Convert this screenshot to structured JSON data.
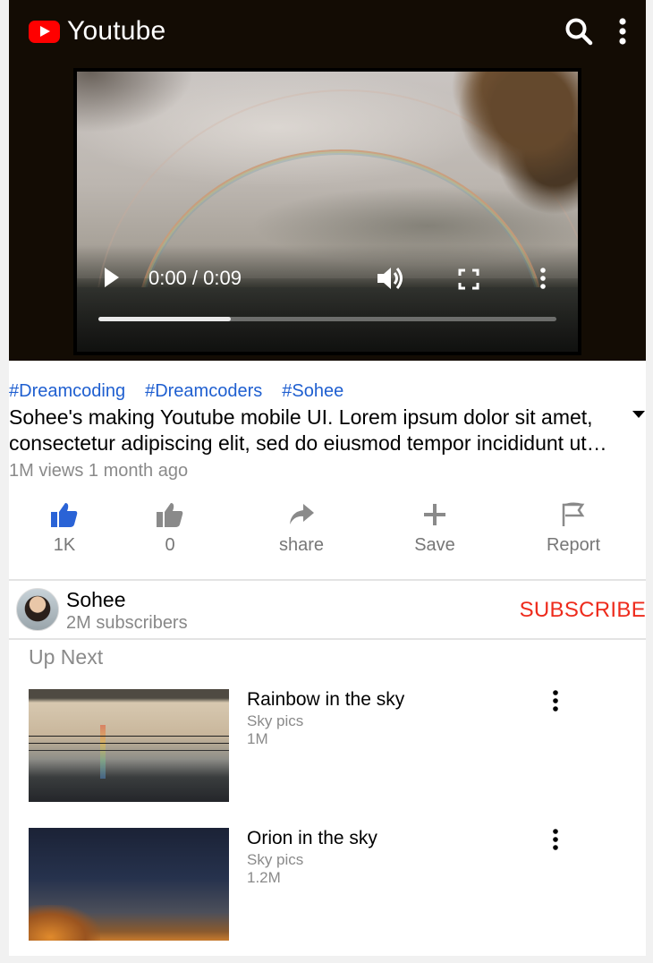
{
  "header": {
    "app_name": "Youtube",
    "icons": [
      "youtube-logo",
      "search-icon",
      "more-vert-icon"
    ]
  },
  "player": {
    "time": "0:00 / 0:09",
    "progress": 0.29,
    "icons": [
      "play-icon",
      "volume-icon",
      "fullscreen-icon",
      "more-vert-icon"
    ]
  },
  "video": {
    "hashtags": [
      "#Dreamcoding",
      "#Dreamcoders",
      "#Sohee"
    ],
    "title": "Sohee's making Youtube mobile UI. Lorem ipsum dolor sit amet, consectetur adipiscing elit, sed do eiusmod tempor incididunt ut labore et dolore magna aliqua.",
    "meta": "1M views 1 month ago"
  },
  "actions": [
    {
      "name": "like",
      "label": "1K",
      "icon": "thumbs-up-icon",
      "color": "#2a63d6"
    },
    {
      "name": "dislike",
      "label": "0",
      "icon": "thumbs-down-icon",
      "color": "#888888"
    },
    {
      "name": "share",
      "label": "share",
      "icon": "share-icon",
      "color": "#888888"
    },
    {
      "name": "save",
      "label": "Save",
      "icon": "plus-icon",
      "color": "#888888"
    },
    {
      "name": "report",
      "label": "Report",
      "icon": "flag-icon",
      "color": "#888888"
    }
  ],
  "channel": {
    "name": "Sohee",
    "subscribers": "2M subscribers",
    "subscribe_label": "SUBSCRIBE"
  },
  "up_next": {
    "heading": "Up Next",
    "items": [
      {
        "title": "Rainbow in the sky",
        "channel": "Sky pics",
        "views": "1M"
      },
      {
        "title": "Orion in the sky",
        "channel": "Sky pics",
        "views": "1.2M"
      }
    ]
  },
  "colors": {
    "header_bg": "#130c04",
    "brand_red": "#ff0000",
    "hashtag_blue": "#1f5fd0",
    "subscribe_red": "#ee2b1c"
  }
}
